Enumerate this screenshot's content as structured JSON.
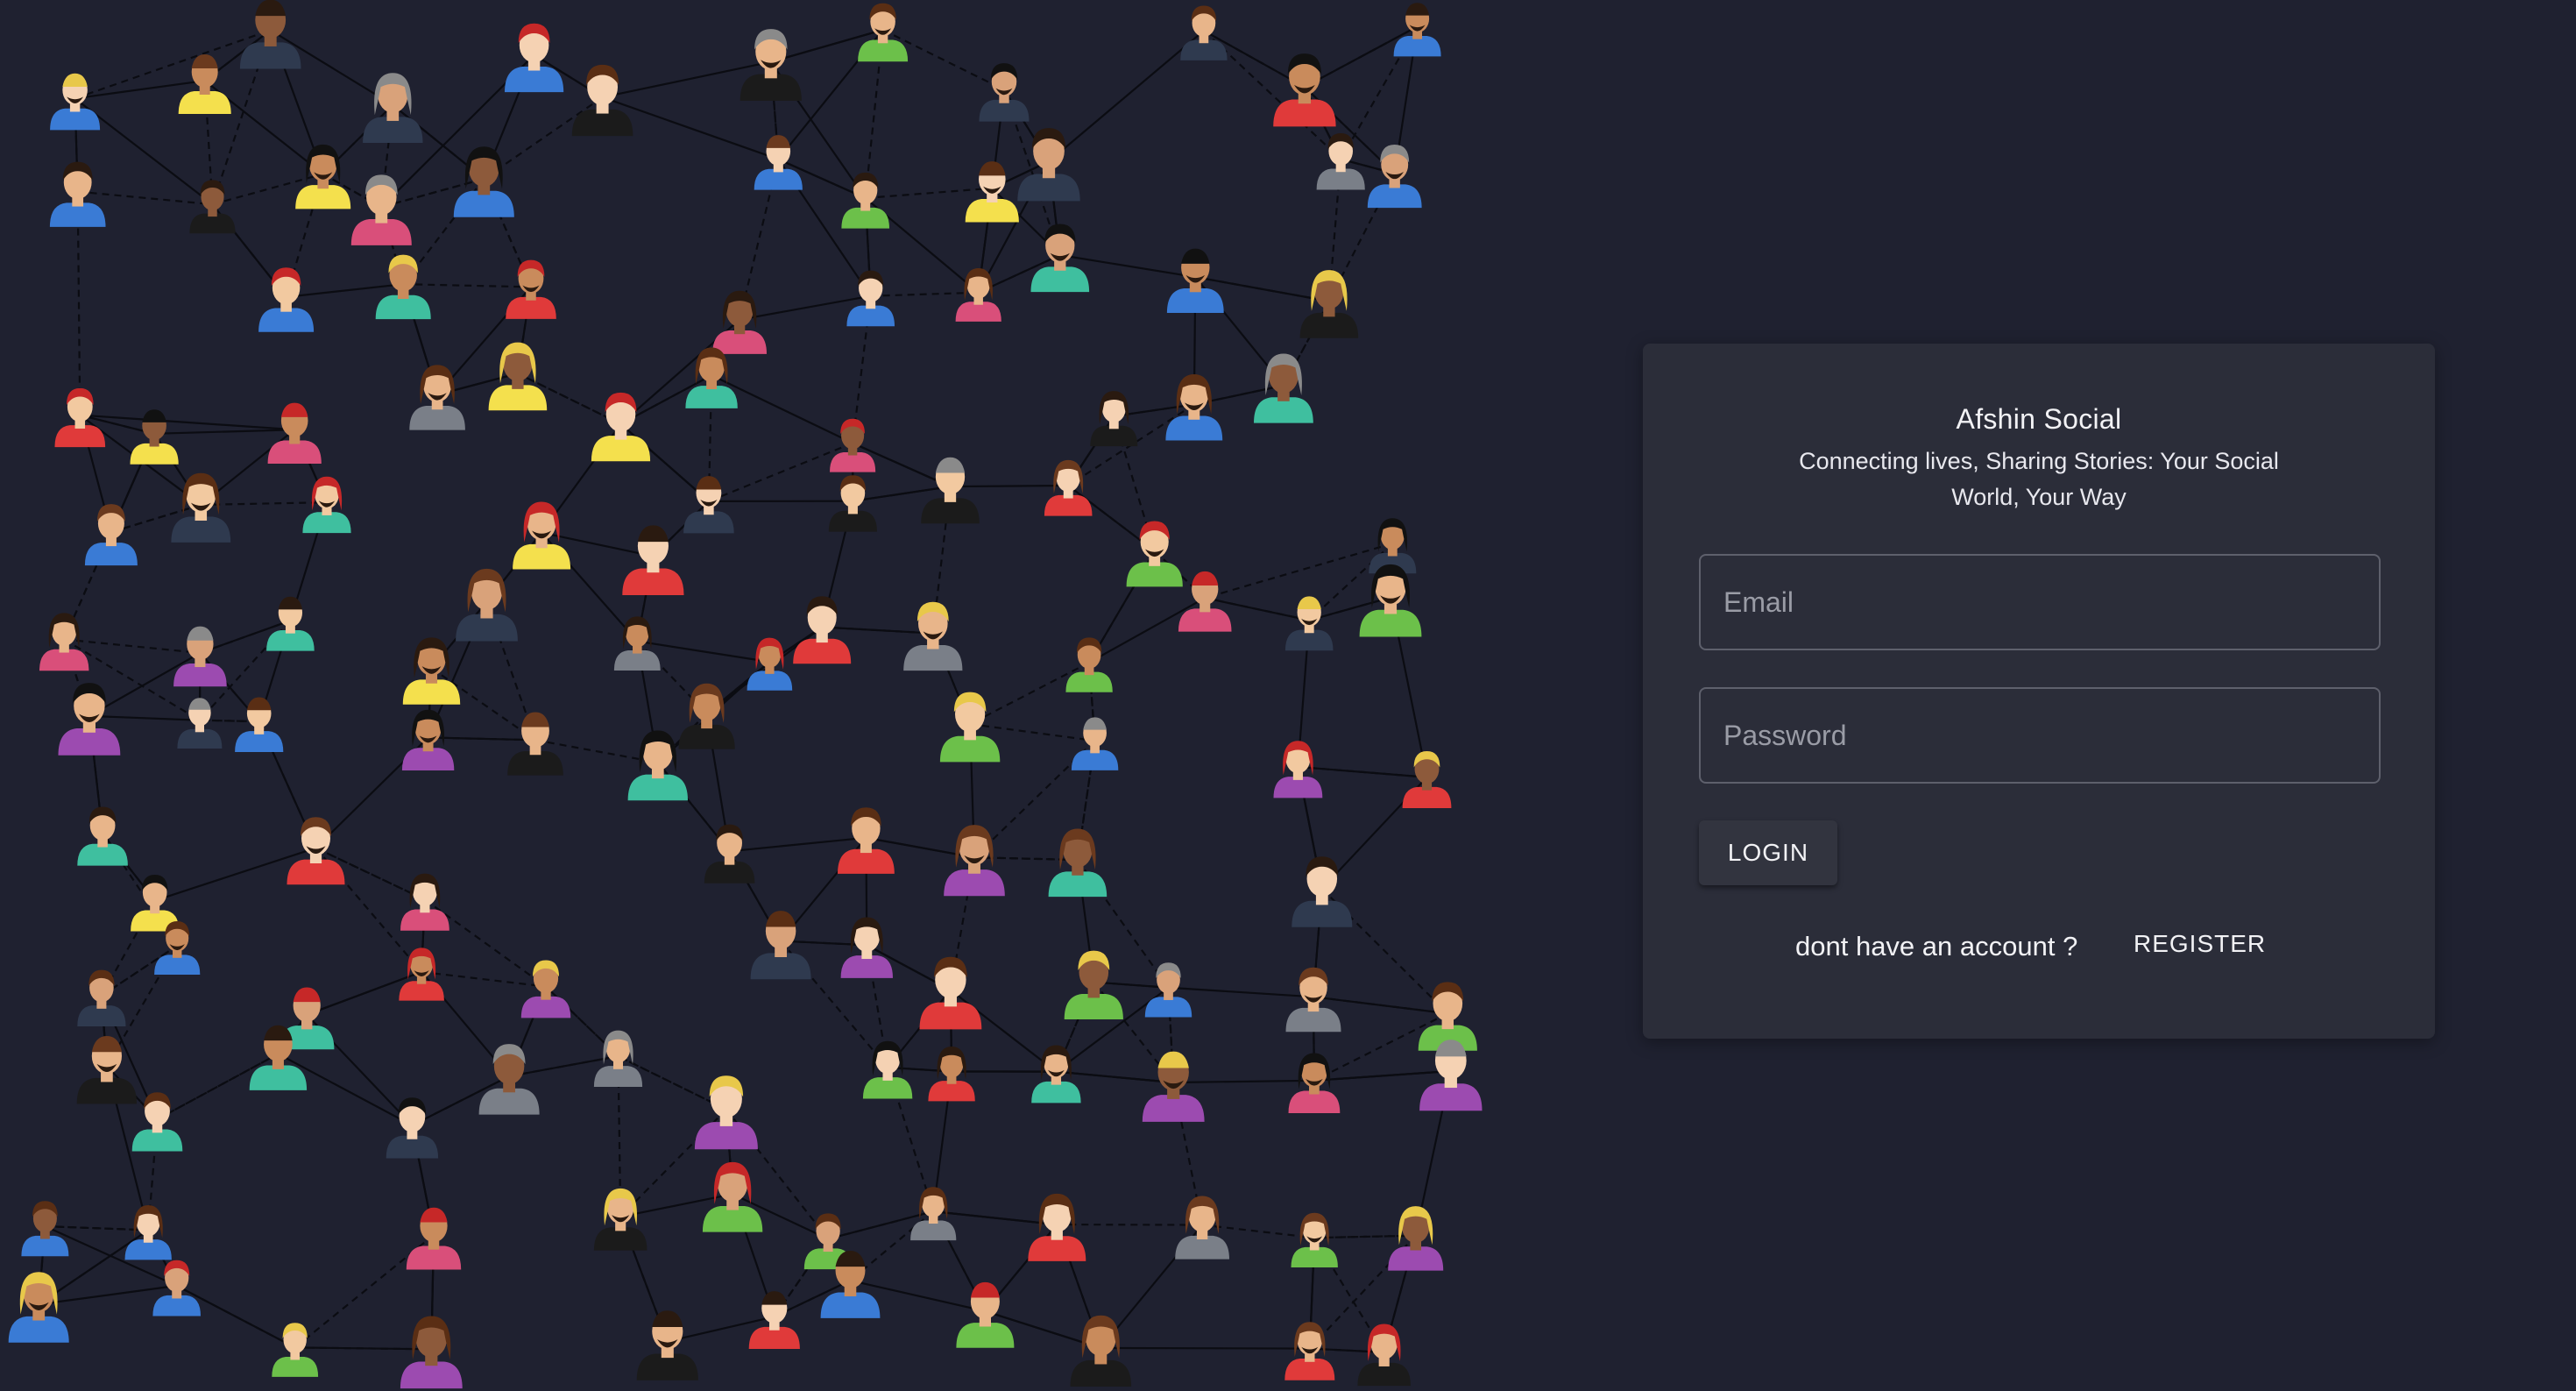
{
  "colors": {
    "background": "#1f2130",
    "card": "#2b2d39",
    "edge": "#000000",
    "text": "#f2f2f5"
  },
  "illustration": {
    "icon": "social-network-people-illustration"
  },
  "login_card": {
    "title": "Afshin Social",
    "subtitle": "Connecting lives, Sharing Stories: Your Social World, Your Way",
    "email_placeholder": "Email",
    "email_value": "",
    "password_placeholder": "Password",
    "password_value": "",
    "login_label": "LOGIN",
    "register_prompt": "dont have an account ?",
    "register_label": "REGISTER"
  }
}
